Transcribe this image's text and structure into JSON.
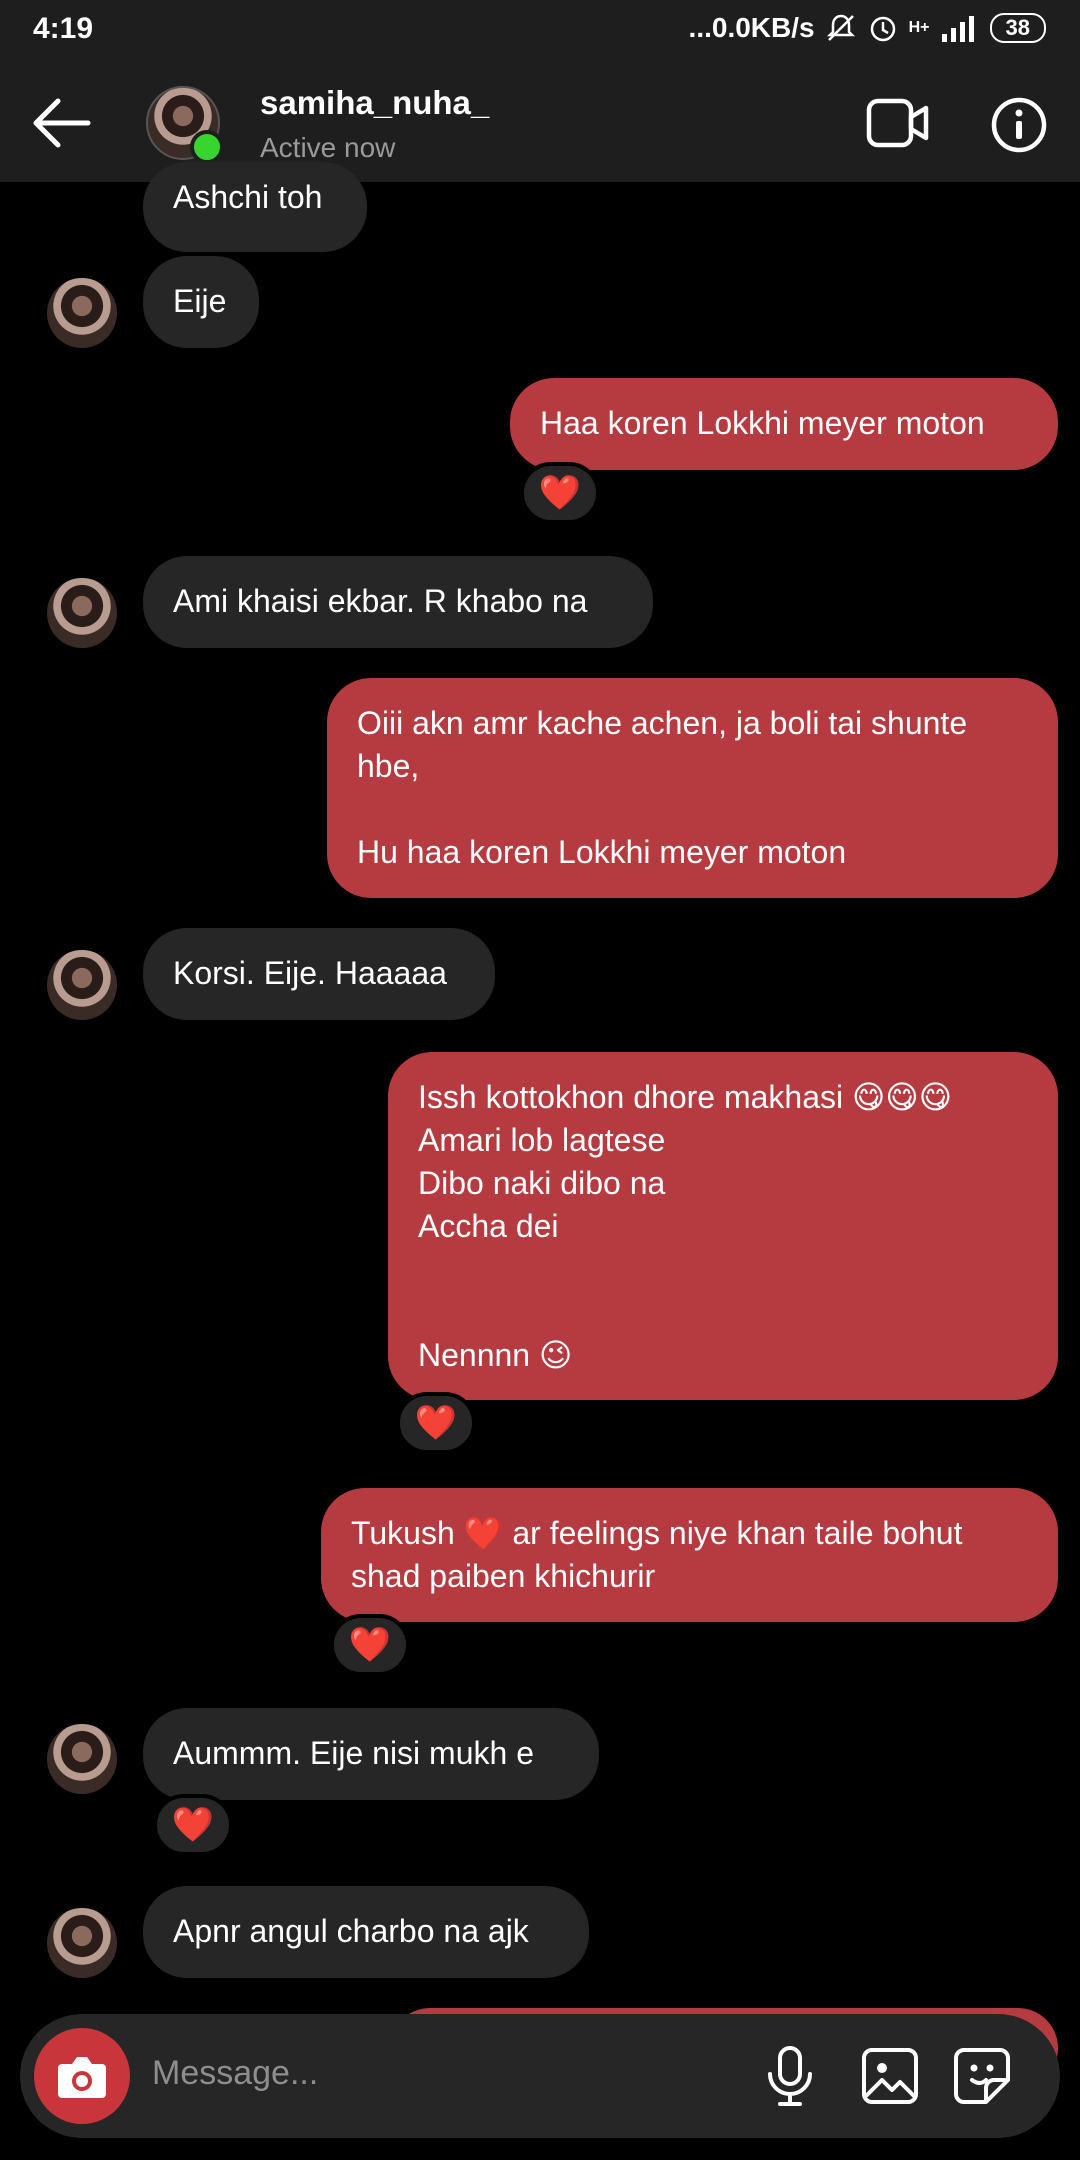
{
  "status": {
    "time": "4:19",
    "network": "...0.0KB/s",
    "signal": "H+",
    "battery": "38"
  },
  "header": {
    "username": "samiha_nuha_",
    "status": "Active now"
  },
  "messages": [
    {
      "text": "Ashchi toh"
    },
    {
      "text": "Eije"
    },
    {
      "text": "Haa koren Lokkhi meyer moton"
    },
    {
      "text": "Ami khaisi ekbar. R khabo na"
    },
    {
      "text": "Oiii akn amr kache achen, ja boli tai shunte hbe,\n\nHu haa koren Lokkhi meyer moton"
    },
    {
      "text": "Korsi. Eije. Haaaaa"
    },
    {
      "text": "Issh kottokhon dhore makhasi 😋😋😋\nAmari lob lagtese\nDibo naki dibo na\nAccha dei\n\n\nNennnn 😉"
    },
    {
      "text": "Tukush ❤️ ar feelings niye khan taile bohut shad paiben khichurir"
    },
    {
      "text": "Aummm. Eije nisi mukh e"
    },
    {
      "text": "Apnr angul charbo na ajk"
    }
  ],
  "reaction": "❤️",
  "composer": {
    "placeholder": "Message..."
  },
  "colors": {
    "outgoing": "#b53b40",
    "incoming": "#262626",
    "online": "#38d430"
  }
}
